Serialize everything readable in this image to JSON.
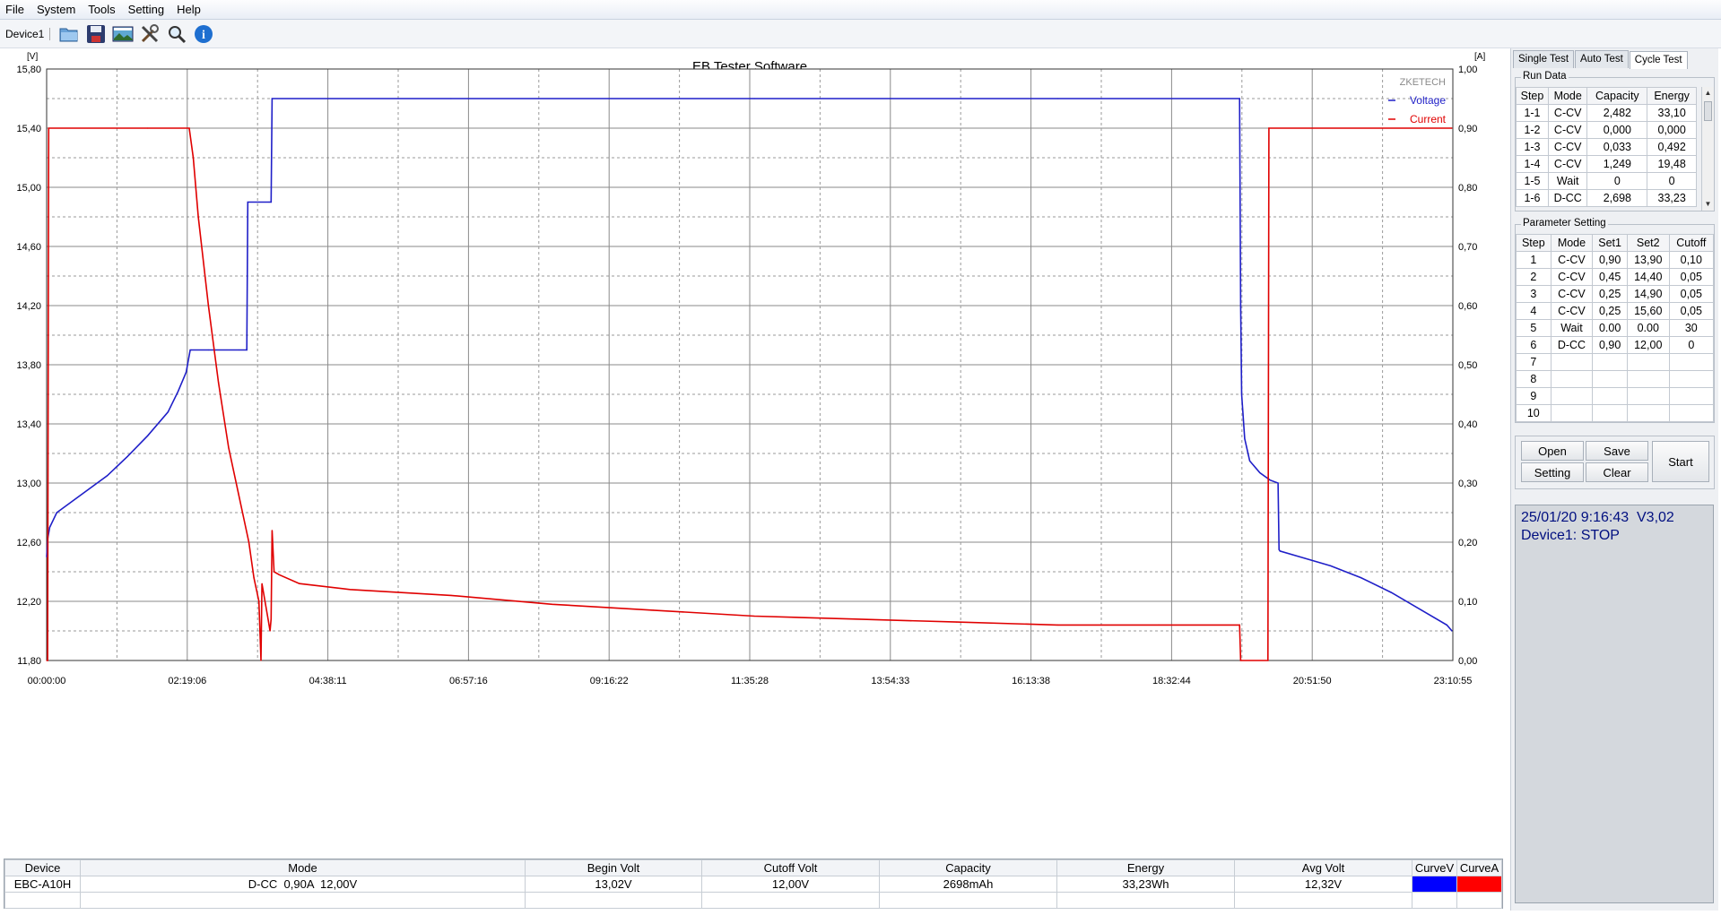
{
  "menu": [
    "File",
    "System",
    "Tools",
    "Setting",
    "Help"
  ],
  "toolbar": {
    "device": "Device1",
    "icons": [
      "folder-icon",
      "save-icon",
      "image-icon",
      "tools-icon",
      "search-icon",
      "info-icon"
    ]
  },
  "chart_data": {
    "type": "line",
    "title": "EB Tester Software",
    "watermark": "ZKETECH",
    "left_unit": "[V]",
    "right_unit": "[A]",
    "y_left_range": [
      11.8,
      15.8
    ],
    "y_left_ticks": [
      "15,80",
      "15,40",
      "15,00",
      "14,60",
      "14,20",
      "13,80",
      "13,40",
      "13,00",
      "12,60",
      "12,20",
      "11,80"
    ],
    "y_right_range": [
      0.0,
      1.0
    ],
    "y_right_ticks": [
      "1,00",
      "0,90",
      "0,80",
      "0,70",
      "0,60",
      "0,50",
      "0,40",
      "0,30",
      "0,20",
      "0,10",
      "0,00"
    ],
    "x_range_minutes": [
      0,
      1390.9
    ],
    "x_ticks": [
      "00:00:00",
      "02:19:06",
      "04:38:11",
      "06:57:16",
      "09:16:22",
      "11:35:28",
      "13:54:33",
      "16:13:38",
      "18:32:44",
      "20:51:50",
      "23:10:55"
    ],
    "grid": true,
    "legend_position": "top-right",
    "series": [
      {
        "name": "Voltage",
        "axis": "left",
        "color": "#1f1fc8",
        "x": [
          0,
          1,
          3,
          10,
          30,
          60,
          80,
          100,
          120,
          130,
          138,
          142,
          143,
          160,
          190,
          198,
          199,
          220,
          222,
          223,
          400,
          700,
          1000,
          1180,
          1181,
          1182,
          1185,
          1190,
          1200,
          1210,
          1218,
          1219,
          1220,
          1240,
          1270,
          1300,
          1330,
          1360,
          1385,
          1390
        ],
        "y": [
          12.5,
          12.62,
          12.7,
          12.8,
          12.9,
          13.05,
          13.18,
          13.32,
          13.48,
          13.62,
          13.75,
          13.9,
          13.9,
          13.9,
          13.9,
          13.9,
          14.9,
          14.9,
          14.9,
          15.6,
          15.6,
          15.6,
          15.6,
          15.6,
          14.2,
          13.6,
          13.3,
          13.15,
          13.07,
          13.02,
          13.0,
          12.55,
          12.54,
          12.5,
          12.44,
          12.36,
          12.26,
          12.14,
          12.04,
          12.0
        ]
      },
      {
        "name": "Current",
        "axis": "right",
        "color": "#e00000",
        "x": [
          0,
          1,
          2,
          100,
          141,
          145,
          150,
          160,
          170,
          180,
          190,
          200,
          205,
          210,
          212,
          213,
          219,
          220,
          221,
          222,
          223,
          225,
          230,
          250,
          300,
          400,
          500,
          600,
          700,
          800,
          900,
          1000,
          1100,
          1180,
          1181,
          1208,
          1209,
          1390
        ],
        "y": [
          0.0,
          0.0,
          0.9,
          0.9,
          0.9,
          0.85,
          0.75,
          0.6,
          0.47,
          0.36,
          0.28,
          0.2,
          0.14,
          0.1,
          0.0,
          0.13,
          0.07,
          0.06,
          0.05,
          0.07,
          0.22,
          0.15,
          0.145,
          0.13,
          0.12,
          0.11,
          0.095,
          0.085,
          0.075,
          0.07,
          0.065,
          0.06,
          0.06,
          0.06,
          0.0,
          0.0,
          0.9,
          0.9
        ]
      }
    ]
  },
  "summary": {
    "headers": [
      "Device",
      "Mode",
      "Begin Volt",
      "Cutoff Volt",
      "Capacity",
      "Energy",
      "Avg Volt",
      "CurveV",
      "CurveA"
    ],
    "values": [
      "EBC-A10H",
      "D-CC  0,90A  12,00V",
      "13,02V",
      "12,00V",
      "2698mAh",
      "33,23Wh",
      "12,32V"
    ],
    "curve_v_color": "#0000ff",
    "curve_a_color": "#ff0000"
  },
  "tabs": [
    "Single Test",
    "Auto Test",
    "Cycle Test"
  ],
  "run_data": {
    "title": "Run Data",
    "headers": [
      "Step",
      "Mode",
      "Capacity",
      "Energy"
    ],
    "rows": [
      [
        "1-1",
        "C-CV",
        "2,482",
        "33,10"
      ],
      [
        "1-2",
        "C-CV",
        "0,000",
        "0,000"
      ],
      [
        "1-3",
        "C-CV",
        "0,033",
        "0,492"
      ],
      [
        "1-4",
        "C-CV",
        "1,249",
        "19,48"
      ],
      [
        "1-5",
        "Wait",
        "0",
        "0"
      ],
      [
        "1-6",
        "D-CC",
        "2,698",
        "33,23"
      ]
    ]
  },
  "parameter_setting": {
    "title": "Parameter Setting",
    "headers": [
      "Step",
      "Mode",
      "Set1",
      "Set2",
      "Cutoff"
    ],
    "rows": [
      [
        "1",
        "C-CV",
        "0,90",
        "13,90",
        "0,10"
      ],
      [
        "2",
        "C-CV",
        "0,45",
        "14,40",
        "0,05"
      ],
      [
        "3",
        "C-CV",
        "0,25",
        "14,90",
        "0,05"
      ],
      [
        "4",
        "C-CV",
        "0,25",
        "15,60",
        "0,05"
      ],
      [
        "5",
        "Wait",
        "0.00",
        "0.00",
        "30"
      ],
      [
        "6",
        "D-CC",
        "0,90",
        "12,00",
        "0"
      ],
      [
        "7",
        "",
        "",
        "",
        ""
      ],
      [
        "8",
        "",
        "",
        "",
        ""
      ],
      [
        "9",
        "",
        "",
        "",
        ""
      ],
      [
        "10",
        "",
        "",
        "",
        ""
      ]
    ]
  },
  "buttons": {
    "open": "Open",
    "save": "Save",
    "setting": "Setting",
    "clear": "Clear",
    "start": "Start"
  },
  "status": {
    "line1": "25/01/20 9:16:43  V3,02",
    "line2": "Device1: STOP"
  }
}
